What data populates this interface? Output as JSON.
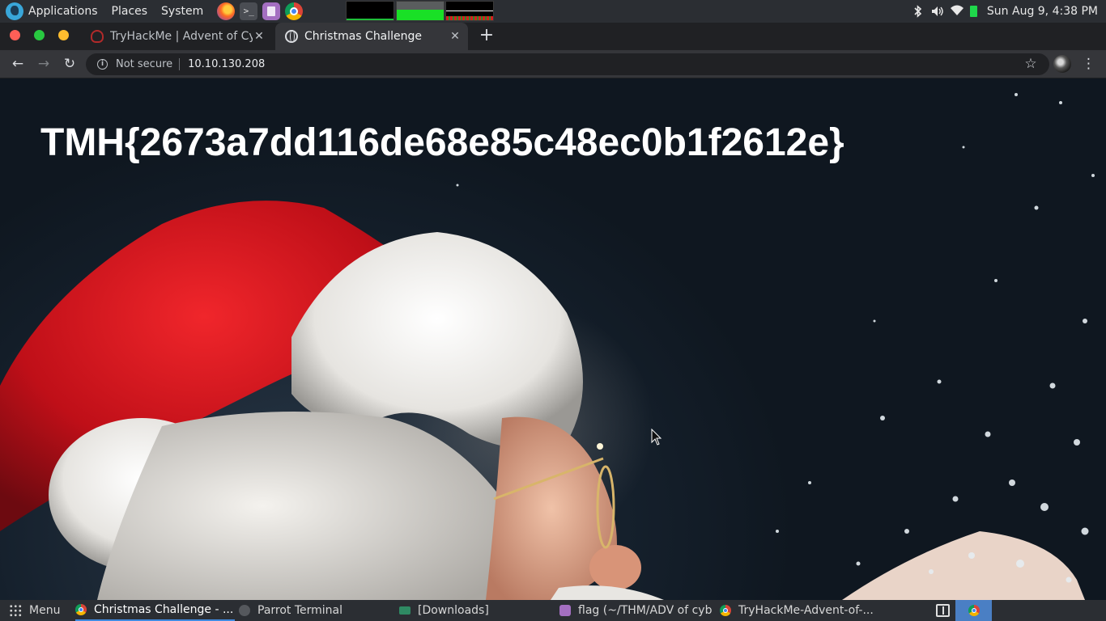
{
  "top_panel": {
    "menus": [
      "Applications",
      "Places",
      "System"
    ],
    "launchers": [
      "firefox-icon",
      "terminal-icon",
      "text-editor-icon",
      "chrome-icon"
    ],
    "terminal_glyph": ">_",
    "tray_icons": [
      "bluetooth-icon",
      "volume-icon",
      "wifi-icon",
      "battery-icon"
    ],
    "clock": "Sun Aug  9,  4:38 PM"
  },
  "browser": {
    "tabs": [
      {
        "title": "TryHackMe | Advent of Cyber",
        "active": false
      },
      {
        "title": "Christmas Challenge",
        "active": true
      }
    ],
    "close_glyph": "✕",
    "new_tab_glyph": "+",
    "nav": {
      "back": "←",
      "forward": "→",
      "reload": "↻"
    },
    "omnibox": {
      "security_label": "Not secure",
      "url": "10.10.130.208"
    },
    "star_glyph": "☆",
    "menu_glyph": "⋮"
  },
  "page": {
    "flag_text": "TMH{2673a7dd116de68e85c48ec0b1f2612e}"
  },
  "taskbar": {
    "menu_label": "Menu",
    "items": [
      {
        "label": "Christmas Challenge - ...",
        "icon": "chrome-icon",
        "active": true
      },
      {
        "label": "Parrot Terminal",
        "icon": "terminal-icon",
        "active": false
      },
      {
        "label": "[Downloads]",
        "icon": "folder-icon",
        "active": false
      },
      {
        "label": "flag (~/THM/ADV of cyb...",
        "icon": "text-editor-icon",
        "active": false
      },
      {
        "label": "TryHackMe-Advent-of-...",
        "icon": "chrome-icon",
        "active": false
      }
    ]
  },
  "colors": {
    "panel_bg": "#2b2e33",
    "browser_frame": "#202124",
    "active_tab": "#35363a",
    "santa_hat_red": "#c8141c",
    "page_bg": "#15202c"
  }
}
